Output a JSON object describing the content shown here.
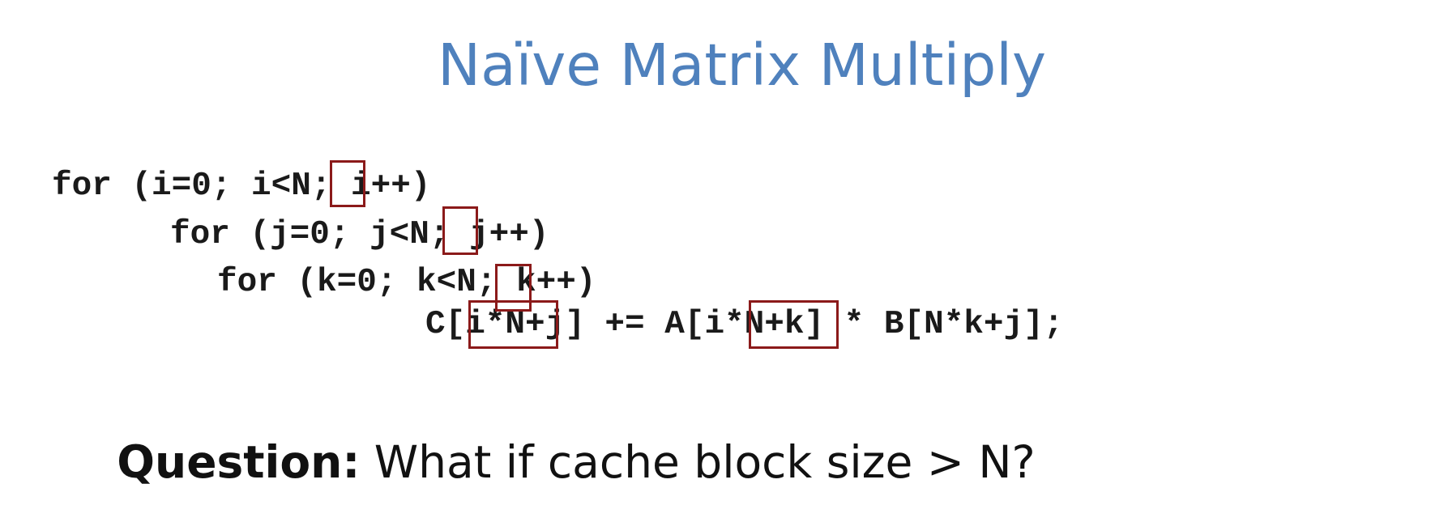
{
  "slide": {
    "title": "Naïve Matrix Multiply",
    "code_lines": [
      "for (i=0; i<N; i++)",
      "for (j=0; j<N; j++)",
      "for (k=0; k<N; k++)",
      "C[i*N+j] += A[i*N+k] * B[N*k+j];"
    ],
    "question_label": "Question:",
    "question_text": " What if cache block size > N?",
    "highlight_color": "#8b1a1a",
    "title_color": "#4f81bd"
  }
}
